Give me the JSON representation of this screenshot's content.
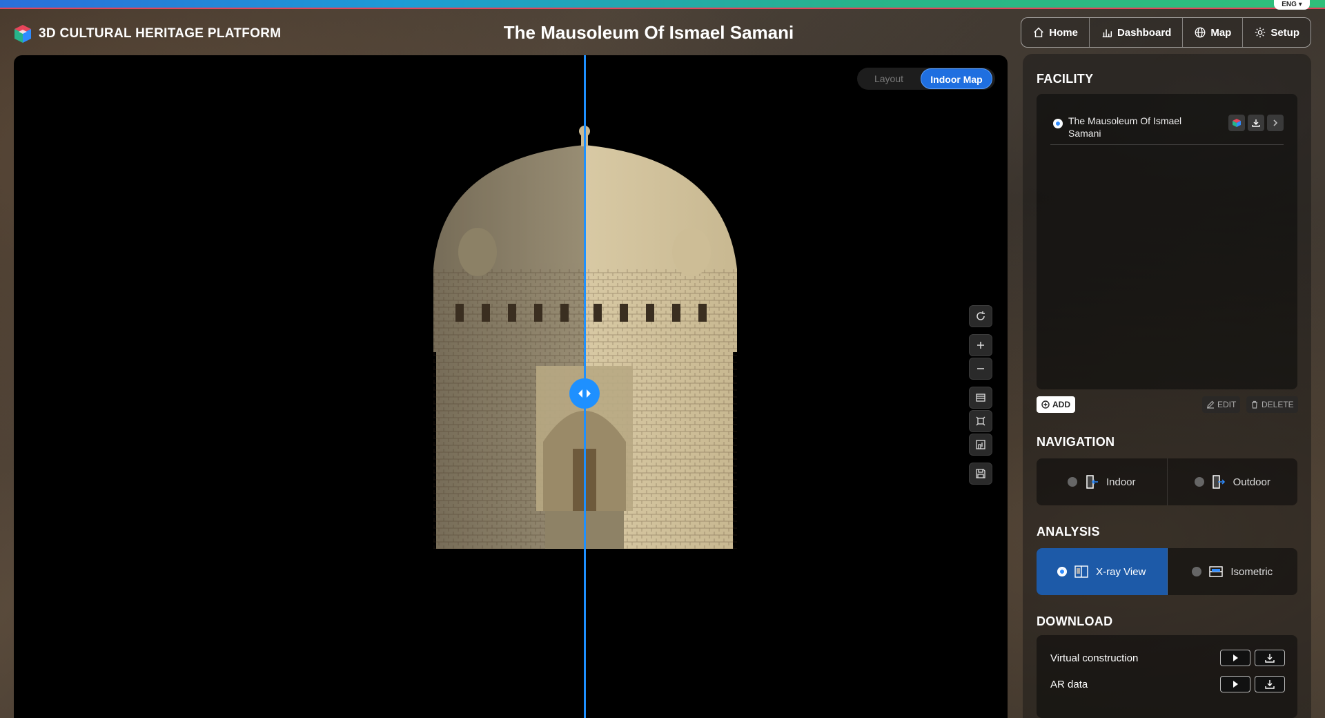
{
  "lang": "ENG ▾",
  "brand": {
    "name": "3D CULTURAL HERITAGE PLATFORM"
  },
  "page_title": "The Mausoleum Of Ismael Samani",
  "nav": {
    "home": "Home",
    "dashboard": "Dashboard",
    "map": "Map",
    "setup": "Setup"
  },
  "viewer": {
    "toggle_layout": "Layout",
    "toggle_indoor": "Indoor Map",
    "split_position": 0.47
  },
  "facility": {
    "title": "FACILITY",
    "items": [
      {
        "name": "The Mausoleum Of Ismael Samani",
        "selected": true
      }
    ],
    "add_label": "ADD",
    "edit_label": "EDIT",
    "delete_label": "DELETE"
  },
  "navigation": {
    "title": "NAVIGATION",
    "indoor": "Indoor",
    "outdoor": "Outdoor"
  },
  "analysis": {
    "title": "ANALYSIS",
    "xray": "X-ray View",
    "isometric": "Isometric",
    "selected": "X-ray View"
  },
  "download": {
    "title": "DOWNLOAD",
    "items": [
      {
        "label": "Virtual construction"
      },
      {
        "label": "AR data"
      }
    ]
  },
  "colors": {
    "accent": "#1f6fe0",
    "split_line": "#1e90ff",
    "active_option": "#1d5aa8"
  }
}
